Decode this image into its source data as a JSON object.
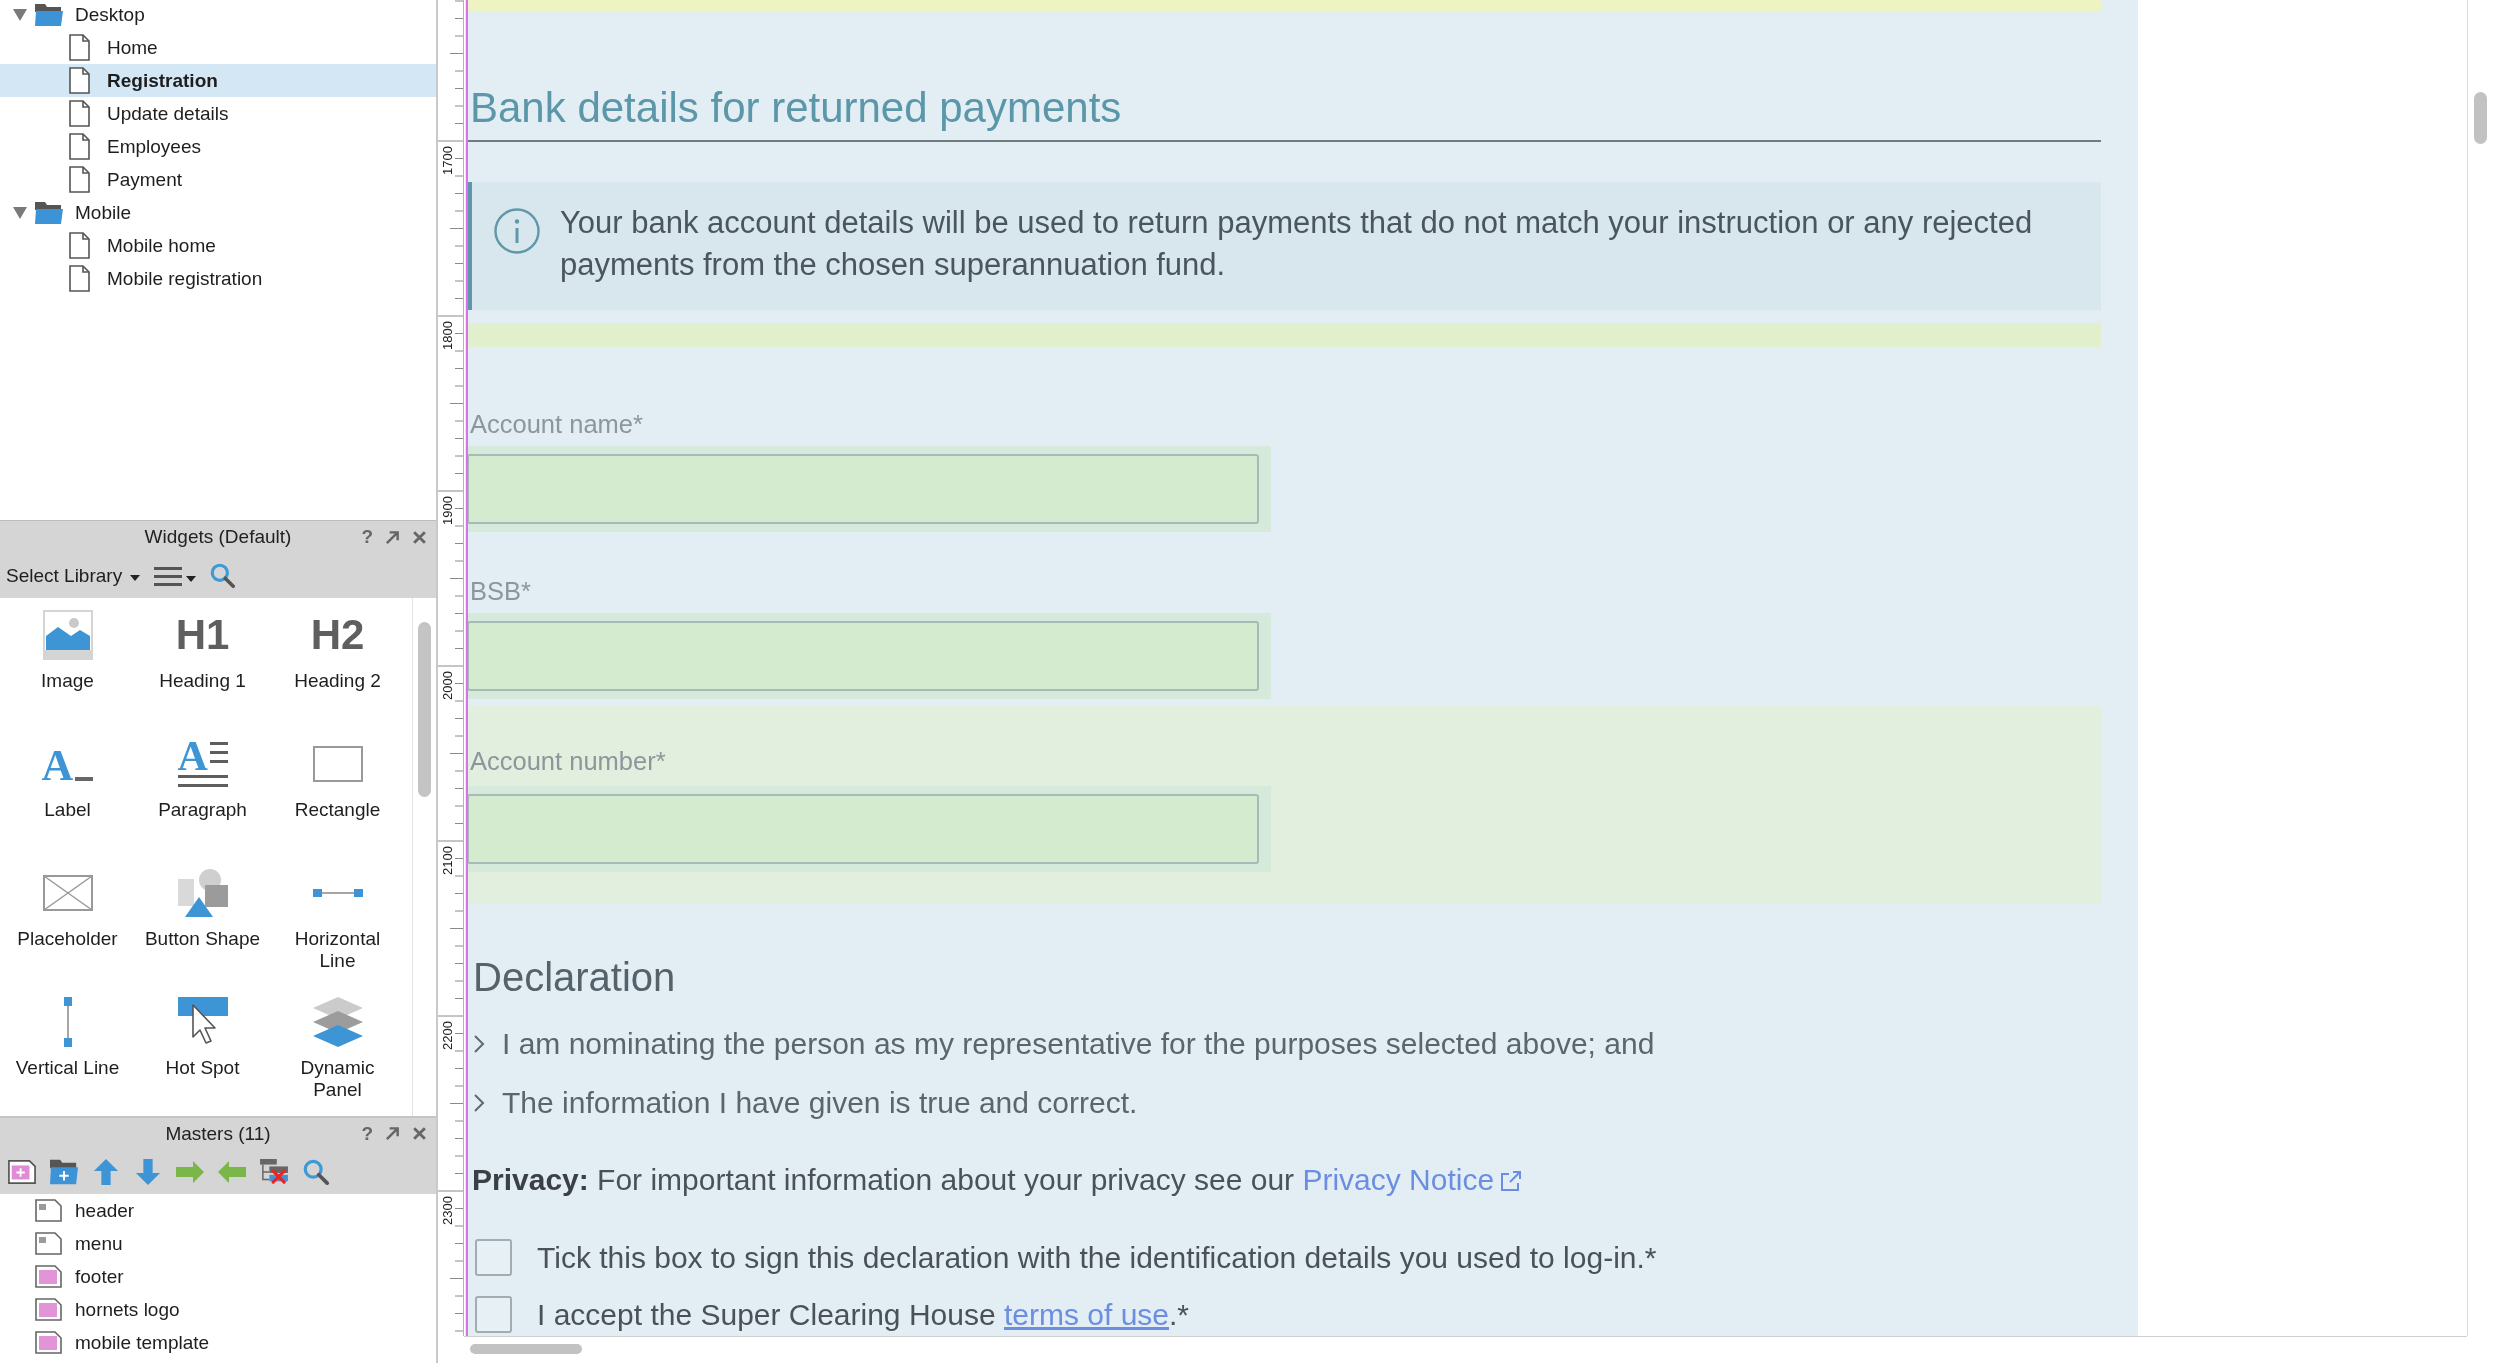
{
  "pages_panel": {
    "tree": [
      {
        "label": "Desktop",
        "kind": "folder",
        "expanded": true,
        "selected": false,
        "children": [
          {
            "label": "Home",
            "kind": "page",
            "selected": false
          },
          {
            "label": "Registration",
            "kind": "page",
            "selected": true
          },
          {
            "label": "Update details",
            "kind": "page",
            "selected": false
          },
          {
            "label": "Employees",
            "kind": "page",
            "selected": false
          },
          {
            "label": "Payment",
            "kind": "page",
            "selected": false
          }
        ]
      },
      {
        "label": "Mobile",
        "kind": "folder",
        "expanded": true,
        "selected": false,
        "children": [
          {
            "label": "Mobile home",
            "kind": "page",
            "selected": false
          },
          {
            "label": "Mobile registration",
            "kind": "page",
            "selected": false
          }
        ]
      }
    ]
  },
  "widgets_panel": {
    "title": "Widgets (Default)",
    "help": "?",
    "library_select": "Select Library",
    "widgets": [
      {
        "label": "Image",
        "kind": "image"
      },
      {
        "label": "Heading 1",
        "kind": "heading",
        "glyph": "H1"
      },
      {
        "label": "Heading 2",
        "kind": "heading",
        "glyph": "H2"
      },
      {
        "label": "Label",
        "kind": "label",
        "glyph": "A"
      },
      {
        "label": "Paragraph",
        "kind": "paragraph",
        "glyph": "A"
      },
      {
        "label": "Rectangle",
        "kind": "rectangle"
      },
      {
        "label": "Placeholder",
        "kind": "placeholder"
      },
      {
        "label": "Button Shape",
        "kind": "shape"
      },
      {
        "label": "Horizontal Line",
        "kind": "hline"
      },
      {
        "label": "Vertical Line",
        "kind": "vline"
      },
      {
        "label": "Hot Spot",
        "kind": "hotspot"
      },
      {
        "label": "Dynamic Panel",
        "kind": "panel"
      }
    ]
  },
  "masters_panel": {
    "title": "Masters (11)",
    "help": "?",
    "masters": [
      {
        "label": "header",
        "kind": "plain"
      },
      {
        "label": "menu",
        "kind": "plain"
      },
      {
        "label": "footer",
        "kind": "filled"
      },
      {
        "label": "hornets logo",
        "kind": "filled"
      },
      {
        "label": "mobile template",
        "kind": "filled"
      }
    ]
  },
  "ruler": {
    "labels": [
      "1700",
      "1800",
      "1900",
      "2000",
      "2100",
      "2200",
      "2300"
    ]
  },
  "canvas": {
    "section_title": "Bank details for returned payments",
    "info": {
      "text": "Your bank account details will be used to return payments that do not match your instruction or any rejected payments from the chosen superannuation fund."
    },
    "fields": [
      {
        "label": "Account name*",
        "highlighted": false
      },
      {
        "label": "BSB*",
        "highlighted": false
      },
      {
        "label": "Account number*",
        "highlighted": true
      }
    ],
    "declaration": {
      "title": "Declaration",
      "items": [
        "I am nominating the person as my representative for the purposes selected above; and",
        "The information I have given is true and correct."
      ]
    },
    "privacy": {
      "text": "**Privacy:** For important information about your privacy see our",
      "link": "Privacy Notice"
    },
    "checkboxes": [
      {
        "text": "Tick this box to sign this declaration with the identification details you used to log-in.*",
        "checked": false
      },
      {
        "text": "I accept the Super Clearing House",
        "link": "terms of use",
        "after": ".*",
        "checked": false
      }
    ]
  }
}
